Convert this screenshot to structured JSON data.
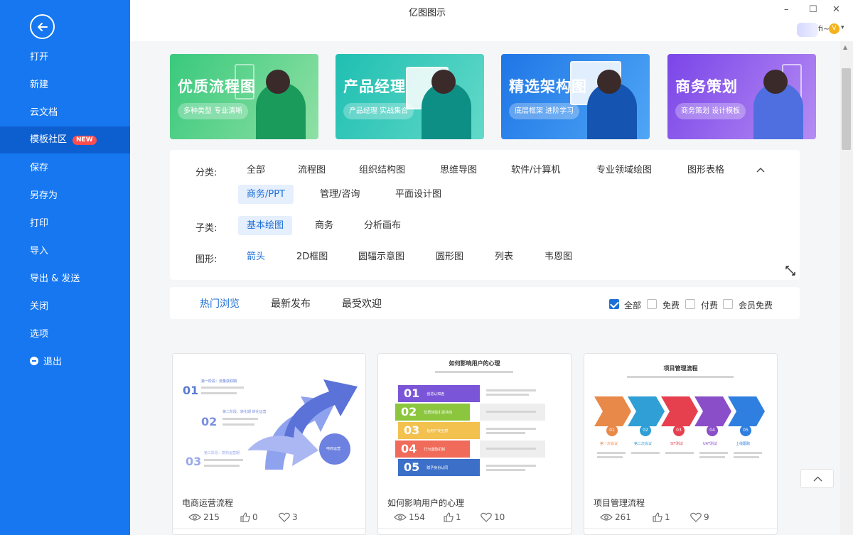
{
  "app": {
    "title": "亿图图示"
  },
  "window": {
    "minimize": "–",
    "maximize": "☐",
    "close": "✕"
  },
  "user": {
    "name": "fi~",
    "vip_icon": "V",
    "caret": "▾"
  },
  "sidebar": {
    "back_icon": "arrow-left-icon",
    "items": [
      {
        "label": "打开"
      },
      {
        "label": "新建"
      },
      {
        "label": "云文档"
      },
      {
        "label": "模板社区",
        "badge": "NEW",
        "active": true
      },
      {
        "label": "保存"
      },
      {
        "label": "另存为"
      },
      {
        "label": "打印"
      },
      {
        "label": "导入"
      },
      {
        "label": "导出 & 发送"
      },
      {
        "label": "关闭"
      },
      {
        "label": "选项"
      },
      {
        "label": "退出"
      }
    ]
  },
  "banners": [
    {
      "title": "优质流程图",
      "subtitle": "多种类型 专业清晰",
      "color_from": "#39c97d",
      "color_to": "#8fe0a4"
    },
    {
      "title": "产品经理",
      "subtitle": "产品经理 实战集合",
      "color_from": "#1fbfb2",
      "color_to": "#63d9c8"
    },
    {
      "title": "精选架构图",
      "subtitle": "底层框架 进阶学习",
      "color_from": "#1f76e6",
      "color_to": "#4fa6f5"
    },
    {
      "title": "商务策划",
      "subtitle": "商务策划 设计模板",
      "color_from": "#7b45e8",
      "color_to": "#b58cf3"
    }
  ],
  "filters": {
    "category_label": "分类:",
    "categories": [
      "全部",
      "流程图",
      "组织结构图",
      "思维导图",
      "软件/计算机",
      "专业领域绘图",
      "图形表格",
      "商务/PPT",
      "管理/咨询",
      "平面设计图"
    ],
    "active_category": "商务/PPT",
    "subcategory_label": "子类:",
    "subcategories": [
      "基本绘图",
      "商务",
      "分析画布"
    ],
    "active_subcategory": "基本绘图",
    "shape_label": "图形:",
    "shapes": [
      "箭头",
      "2D框图",
      "圆辐示意图",
      "圆形图",
      "列表",
      "韦恩图"
    ],
    "active_shape": "箭头"
  },
  "sort": {
    "tabs": [
      "热门浏览",
      "最新发布",
      "最受欢迎"
    ],
    "active": "热门浏览",
    "checkboxes": [
      {
        "label": "全部",
        "checked": true
      },
      {
        "label": "免费",
        "checked": false
      },
      {
        "label": "付费",
        "checked": false
      },
      {
        "label": "会员免费",
        "checked": false
      }
    ]
  },
  "cards": [
    {
      "title": "电商运营流程",
      "views": "215",
      "likes": "0",
      "favorites": "3",
      "thumb": {
        "nums": [
          "01",
          "02",
          "03"
        ],
        "step1": "第一阶段：流量获取期",
        "step2": "第二阶段：转化期 转化运营",
        "step3": "第三阶段：复购运营期",
        "badge": "电商运营"
      }
    },
    {
      "title": "如何影响用户的心理",
      "views": "154",
      "likes": "1",
      "favorites": "10",
      "thumb": {
        "heading": "如何影响用户的心理",
        "nums": [
          "01",
          "02",
          "03",
          "04",
          "05"
        ],
        "labels": [
          "创造认知差",
          "优质体验引发共鸣",
          "给用户安全感",
          "行为激励机制",
          "赋予身份认同"
        ]
      }
    },
    {
      "title": "项目管理流程",
      "views": "261",
      "likes": "1",
      "favorites": "9",
      "thumb": {
        "heading": "项目管理流程",
        "nums": [
          "01",
          "02",
          "03",
          "04",
          "05"
        ],
        "labels": [
          "第一次会议",
          "第二次会议",
          "SIT测试",
          "UAT测试",
          "上线跟踪"
        ]
      }
    }
  ],
  "colors": {
    "sidebar": "#1677f0",
    "accent": "#1d6fd6",
    "badge": "#ff4d4f"
  }
}
